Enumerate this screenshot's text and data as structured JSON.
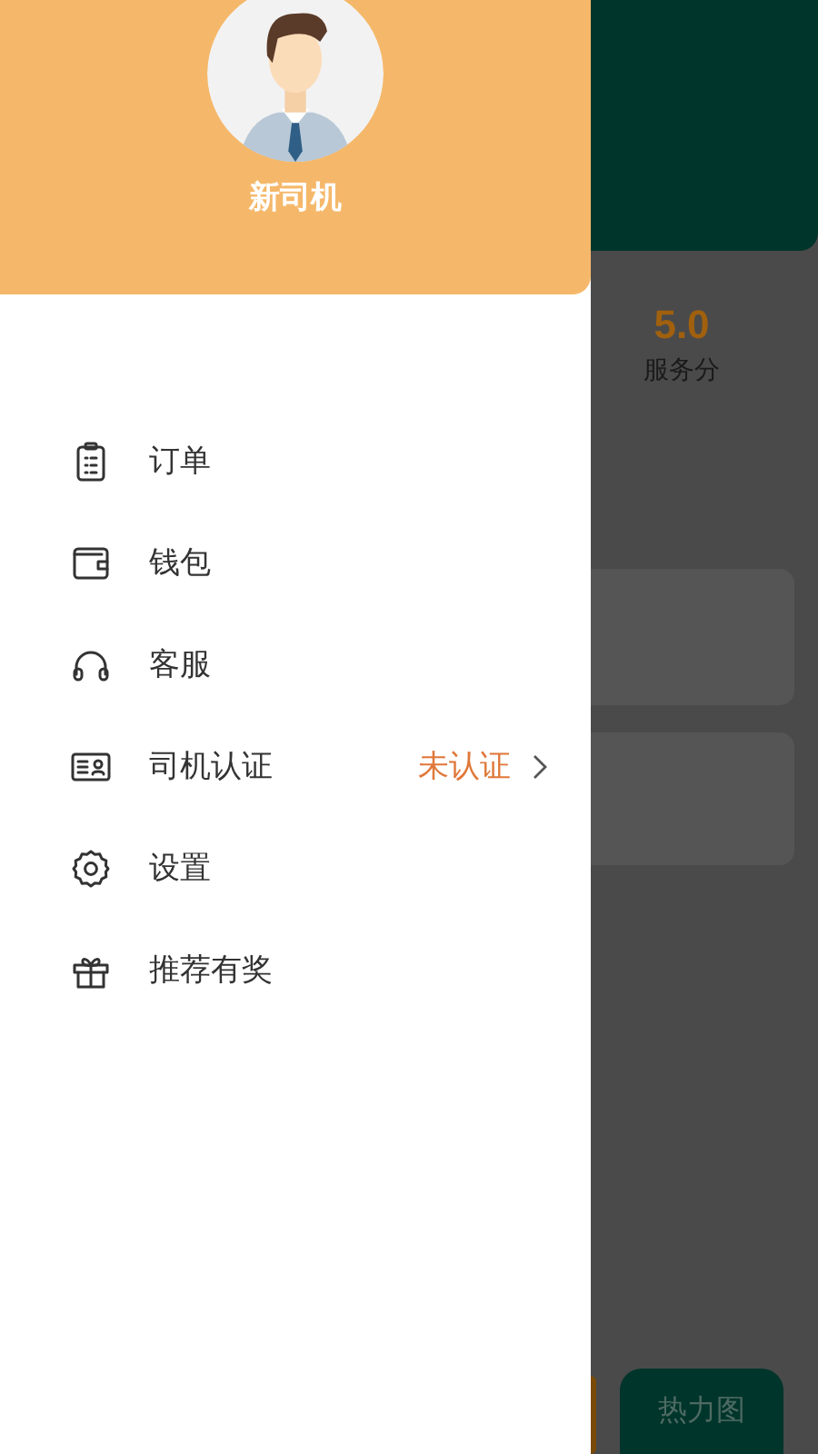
{
  "drawer": {
    "user_name": "新司机",
    "menu": [
      {
        "label": "订单"
      },
      {
        "label": "钱包"
      },
      {
        "label": "客服"
      },
      {
        "label": "司机认证",
        "status": "未认证"
      },
      {
        "label": "设置"
      },
      {
        "label": "推荐有奖"
      }
    ]
  },
  "background": {
    "stat": {
      "value": "5.0",
      "label": "服务分"
    },
    "heatmap_button": "热力图"
  }
}
